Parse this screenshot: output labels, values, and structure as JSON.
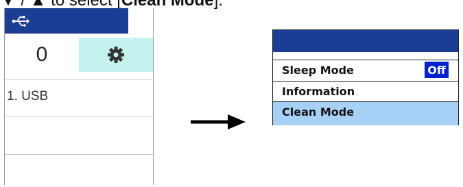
{
  "caption": {
    "prefix": "▼ / ▲ to select [",
    "bold": "Clean Mode",
    "suffix": "]."
  },
  "device": {
    "header_icon": "usb-icon",
    "count": "0",
    "settings_icon": "gear-icon",
    "rows": [
      "1. USB",
      "",
      ""
    ]
  },
  "arrow": {
    "icon": "right-arrow-icon"
  },
  "menu": {
    "items": [
      {
        "label": "Sleep Mode",
        "value": "Off"
      },
      {
        "label": "Information"
      },
      {
        "label": "Clean Mode",
        "selected": true
      }
    ]
  },
  "colors": {
    "header_blue": "#1b3d94",
    "gear_cell_bg": "#c4f2ee",
    "selected_row_bg": "#a7d0f7",
    "value_badge_bg": "#0022cc"
  }
}
